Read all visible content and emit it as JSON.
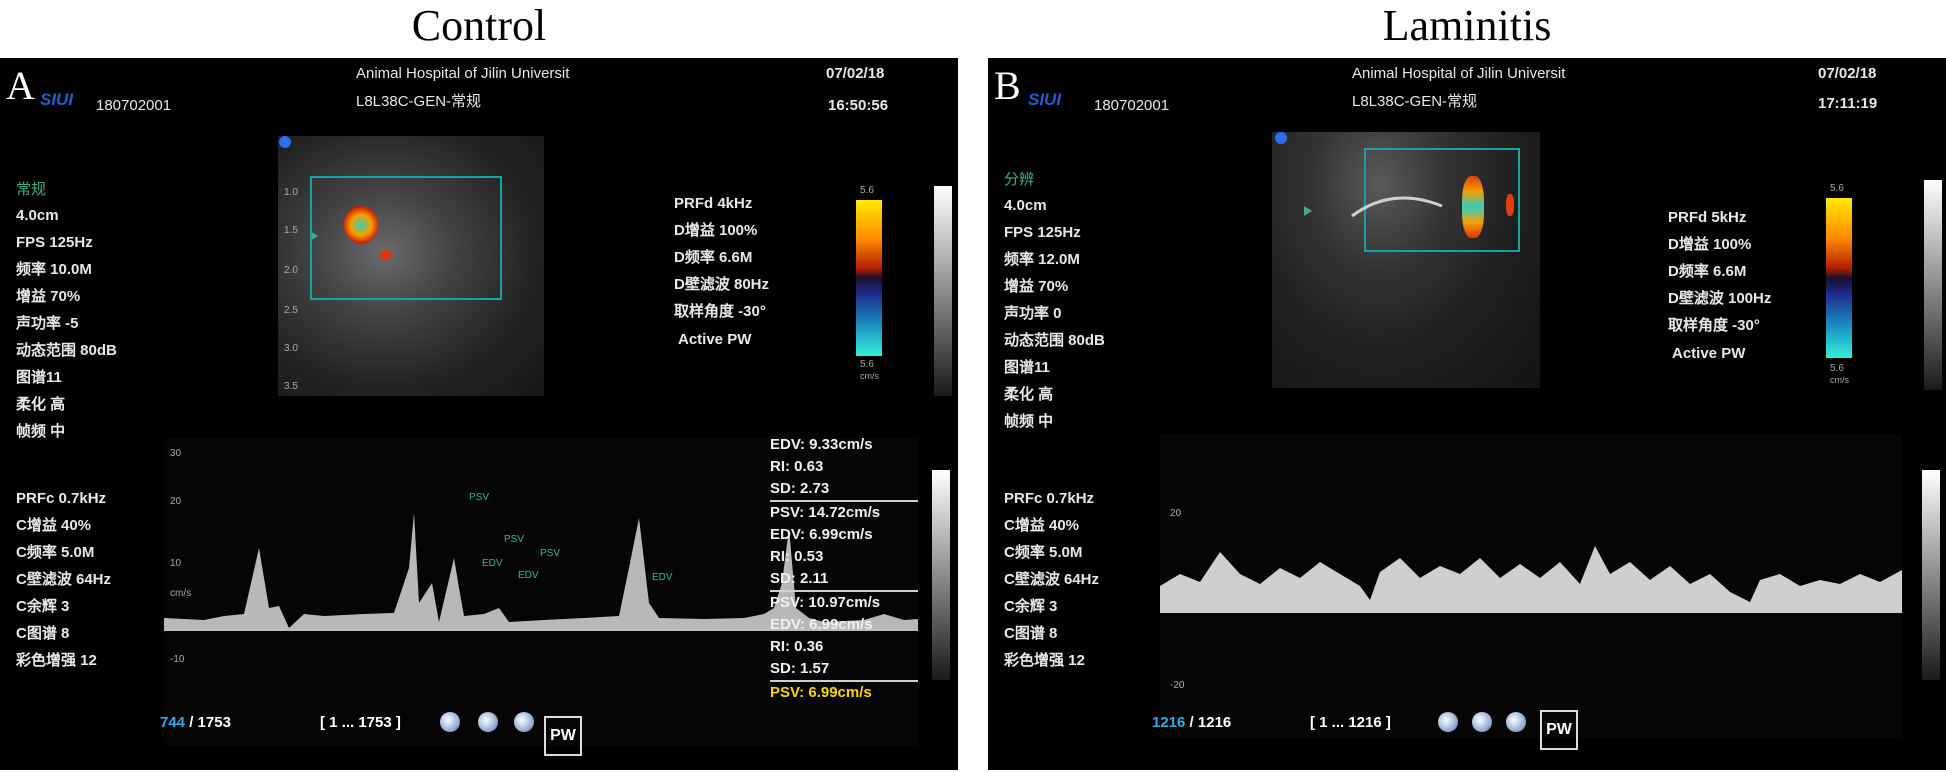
{
  "titles": {
    "left": "Control",
    "right": "Laminitis"
  },
  "colors": {
    "panel_bg": "#000000",
    "roi_box": "#18a3a3",
    "frame_highlight": "#3aa9e6",
    "psv_highlight": "#ffd400",
    "preset_text": "#3fb07a"
  },
  "panels": [
    {
      "label": "A",
      "hospital": "Animal Hospital of Jilin Universit",
      "patient_id": "180702001",
      "probe": "L8L38C-GEN-常规",
      "date": "07/02/18",
      "time": "16:50:56",
      "preset": "常规",
      "params": [
        "4.0cm",
        "FPS 125Hz",
        "频率 10.0M",
        "增益 70%",
        "声功率 -5",
        "动态范围 80dB",
        "图谱11",
        "柔化 高",
        "帧频 中"
      ],
      "doppler_params": [
        "PRFd 4kHz",
        "D增益 100%",
        "D频率 6.6M",
        "D壁滤波 80Hz",
        "取样角度 -30°"
      ],
      "active_mode": "Active PW",
      "colorbar_top": "5.6",
      "colorbar_bottom": "5.6",
      "colorbar_unit": "cm/s",
      "color_params": [
        "PRFc 0.7kHz",
        "C增益 40%",
        "C频率 5.0M",
        "C壁滤波 64Hz",
        "C余辉 3",
        "C图谱 8",
        "彩色增强 12"
      ],
      "depth_ticks": [
        "1.0",
        "1.5",
        "2.0",
        "2.5",
        "3.0",
        "3.5"
      ],
      "spectral_ticks": [
        "30",
        "20",
        "10",
        "cm/s",
        "-10"
      ],
      "measurements": [
        {
          "text": "EDV: 9.33cm/s",
          "highlight": false
        },
        {
          "text": "RI: 0.63",
          "highlight": false
        },
        {
          "text": "SD: 2.73",
          "highlight": false
        },
        {
          "text": "PSV: 14.72cm/s",
          "highlight": false
        },
        {
          "text": "EDV: 6.99cm/s",
          "highlight": false
        },
        {
          "text": "RI: 0.53",
          "highlight": false
        },
        {
          "text": "SD: 2.11",
          "highlight": false
        },
        {
          "text": "PSV: 10.97cm/s",
          "highlight": false
        },
        {
          "text": "EDV: 6.99cm/s",
          "highlight": false
        },
        {
          "text": "RI: 0.36",
          "highlight": false
        },
        {
          "text": "SD: 1.57",
          "highlight": false
        },
        {
          "text": "PSV: 6.99cm/s",
          "highlight": true
        }
      ],
      "spectrum_marks": [
        "PSV",
        "PSV",
        "PSV",
        "EDV",
        "EDV",
        "EDV"
      ],
      "frame_current": "744",
      "frame_total": "/ 1753",
      "range": "[ 1 ... 1753 ]",
      "pw_button": "PW"
    },
    {
      "label": "B",
      "hospital": "Animal Hospital of Jilin Universit",
      "patient_id": "180702001",
      "probe": "L8L38C-GEN-常规",
      "date": "07/02/18",
      "time": "17:11:19",
      "preset": "分辨",
      "params": [
        "4.0cm",
        "FPS 125Hz",
        "频率 12.0M",
        "增益 70%",
        "声功率 0",
        "动态范围 80dB",
        "图谱11",
        "柔化 高",
        "帧频 中"
      ],
      "doppler_params": [
        "PRFd 5kHz",
        "D增益 100%",
        "D频率 6.6M",
        "D壁滤波 100Hz",
        "取样角度 -30°"
      ],
      "active_mode": "Active PW",
      "colorbar_top": "5.6",
      "colorbar_bottom": "5.6",
      "colorbar_unit": "cm/s",
      "color_params": [
        "PRFc 0.7kHz",
        "C增益 40%",
        "C频率 5.0M",
        "C壁滤波 64Hz",
        "C余辉 3",
        "C图谱 8",
        "彩色增强 12"
      ],
      "spectral_ticks": [
        "20",
        "-20"
      ],
      "frame_current": "1216",
      "frame_total": "/ 1216",
      "range": "[ 1 ... 1216 ]",
      "pw_button": "PW"
    }
  ]
}
